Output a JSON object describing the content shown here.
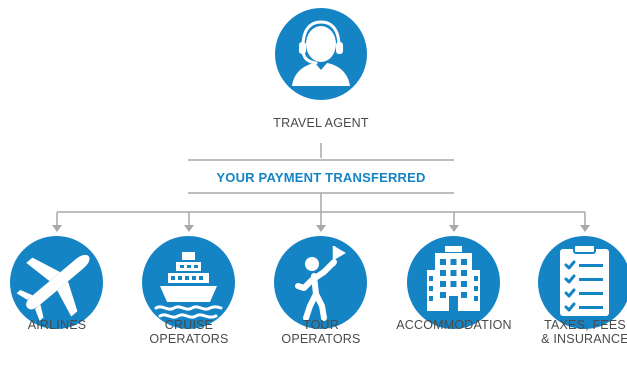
{
  "agent": {
    "label": "TRAVEL AGENT",
    "icon": "headset-agent-icon"
  },
  "payment": {
    "label": "YOUR PAYMENT TRANSFERRED"
  },
  "recipients": [
    {
      "label": "AIRLINES",
      "icon": "airplane-icon"
    },
    {
      "label": "CRUISE\nOPERATORS",
      "icon": "cruise-ship-icon"
    },
    {
      "label": "TOUR\nOPERATORS",
      "icon": "tour-guide-flag-icon"
    },
    {
      "label": "ACCOMMODATION",
      "icon": "hotel-building-icon"
    },
    {
      "label": "TAXES, FEES\n& INSURANCE",
      "icon": "checklist-icon"
    }
  ],
  "colors": {
    "accent": "#1584c4",
    "line": "#a8a8a8",
    "text": "#4a4a4a"
  }
}
